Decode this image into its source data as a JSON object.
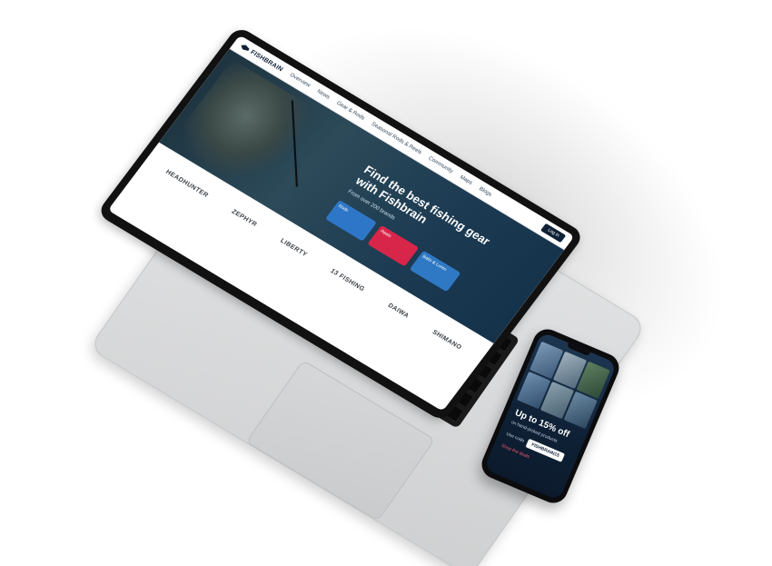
{
  "site": {
    "logo": "FISHBRAIN",
    "nav": [
      "Overview",
      "News",
      "Gear & Rods",
      "Seasonal Rods & Reels",
      "Community",
      "Maps",
      "Blogs"
    ],
    "login": "Log in"
  },
  "hero": {
    "title": "Find the best fishing gear with Fishbrain",
    "subtitle": "From over 200 brands",
    "ctas": [
      "Rods",
      "Reels",
      "Baits & Lures"
    ]
  },
  "brands": [
    "HEADHUNTER",
    "ZEPHYR",
    "LIBERTY",
    "13 FISHING",
    "DAIWA",
    "SHIMANO"
  ],
  "phone": {
    "promo_title": "Up to 15% off",
    "promo_sub": "on hand-picked products",
    "code_label": "Use code",
    "code_value": "FISHBRAIN15",
    "link": "Shop the deals"
  },
  "colors": {
    "navy": "#0f2136",
    "accent_red": "#d7264a",
    "accent_blue": "#2e77c8",
    "laptop_silver": "#dcdddf"
  }
}
